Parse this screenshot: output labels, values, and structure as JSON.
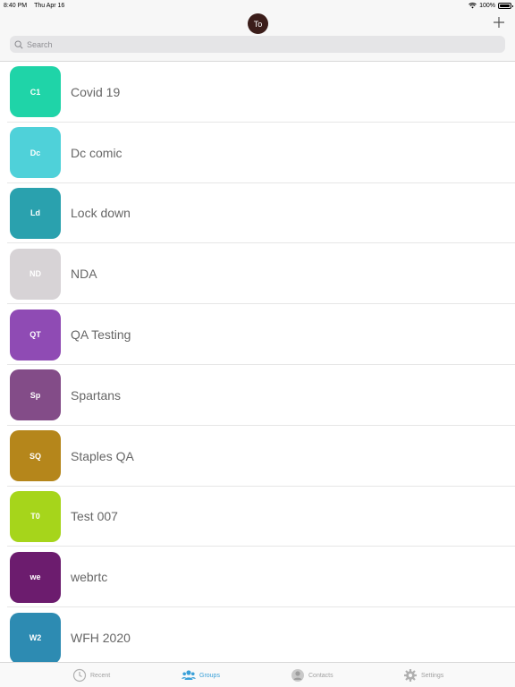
{
  "status_bar": {
    "time": "8:40 PM",
    "date": "Thu Apr 16",
    "battery": "100%"
  },
  "header": {
    "avatar_initials": "To",
    "add_icon": "plus-icon"
  },
  "search": {
    "placeholder": "Search",
    "value": ""
  },
  "groups": [
    {
      "initials": "C1",
      "name": "Covid 19",
      "color": "#1fd4a8"
    },
    {
      "initials": "Dc",
      "name": "Dc comic",
      "color": "#4fd1d9"
    },
    {
      "initials": "Ld",
      "name": "Lock down",
      "color": "#2aa1ae"
    },
    {
      "initials": "ND",
      "name": "NDA",
      "color": "#d7d3d6"
    },
    {
      "initials": "QT",
      "name": "QA Testing",
      "color": "#8f4bb4"
    },
    {
      "initials": "Sp",
      "name": "Spartans",
      "color": "#834c88"
    },
    {
      "initials": "SQ",
      "name": "Staples QA",
      "color": "#b5861b"
    },
    {
      "initials": "T0",
      "name": "Test 007",
      "color": "#a6d51b"
    },
    {
      "initials": "we",
      "name": "webrtc",
      "color": "#6c1c6e"
    },
    {
      "initials": "W2",
      "name": "WFH 2020",
      "color": "#2d8bb2"
    }
  ],
  "tabs": [
    {
      "label": "Recent",
      "icon": "clock-icon",
      "active": false
    },
    {
      "label": "Groups",
      "icon": "group-icon",
      "active": true
    },
    {
      "label": "Contacts",
      "icon": "contact-icon",
      "active": false
    },
    {
      "label": "Settings",
      "icon": "gear-icon",
      "active": false
    }
  ],
  "colors": {
    "accent": "#3aa0d8",
    "avatar": "#3b1d1a"
  }
}
